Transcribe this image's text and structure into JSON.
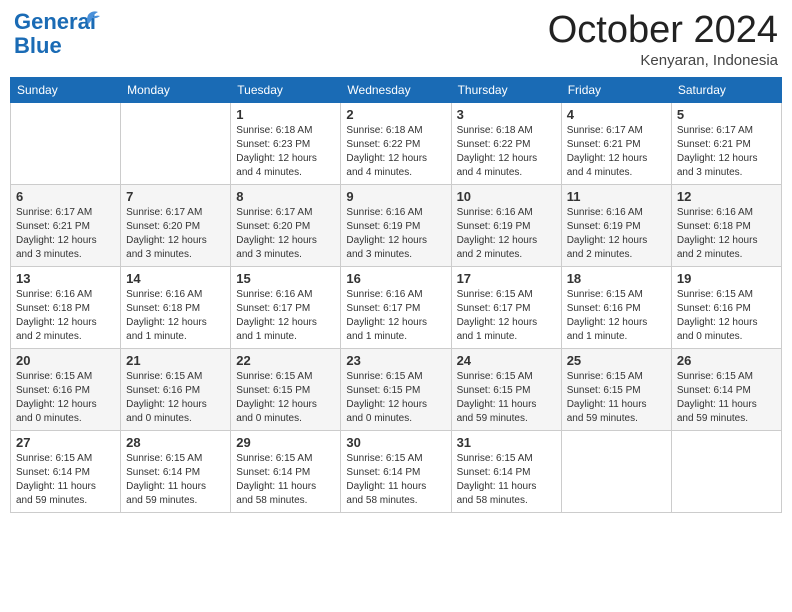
{
  "header": {
    "logo_line1": "General",
    "logo_line2": "Blue",
    "month_title": "October 2024",
    "location": "Kenyaran, Indonesia"
  },
  "weekdays": [
    "Sunday",
    "Monday",
    "Tuesday",
    "Wednesday",
    "Thursday",
    "Friday",
    "Saturday"
  ],
  "weeks": [
    [
      {
        "day": "",
        "info": ""
      },
      {
        "day": "",
        "info": ""
      },
      {
        "day": "1",
        "info": "Sunrise: 6:18 AM\nSunset: 6:23 PM\nDaylight: 12 hours\nand 4 minutes."
      },
      {
        "day": "2",
        "info": "Sunrise: 6:18 AM\nSunset: 6:22 PM\nDaylight: 12 hours\nand 4 minutes."
      },
      {
        "day": "3",
        "info": "Sunrise: 6:18 AM\nSunset: 6:22 PM\nDaylight: 12 hours\nand 4 minutes."
      },
      {
        "day": "4",
        "info": "Sunrise: 6:17 AM\nSunset: 6:21 PM\nDaylight: 12 hours\nand 4 minutes."
      },
      {
        "day": "5",
        "info": "Sunrise: 6:17 AM\nSunset: 6:21 PM\nDaylight: 12 hours\nand 3 minutes."
      }
    ],
    [
      {
        "day": "6",
        "info": "Sunrise: 6:17 AM\nSunset: 6:21 PM\nDaylight: 12 hours\nand 3 minutes."
      },
      {
        "day": "7",
        "info": "Sunrise: 6:17 AM\nSunset: 6:20 PM\nDaylight: 12 hours\nand 3 minutes."
      },
      {
        "day": "8",
        "info": "Sunrise: 6:17 AM\nSunset: 6:20 PM\nDaylight: 12 hours\nand 3 minutes."
      },
      {
        "day": "9",
        "info": "Sunrise: 6:16 AM\nSunset: 6:19 PM\nDaylight: 12 hours\nand 3 minutes."
      },
      {
        "day": "10",
        "info": "Sunrise: 6:16 AM\nSunset: 6:19 PM\nDaylight: 12 hours\nand 2 minutes."
      },
      {
        "day": "11",
        "info": "Sunrise: 6:16 AM\nSunset: 6:19 PM\nDaylight: 12 hours\nand 2 minutes."
      },
      {
        "day": "12",
        "info": "Sunrise: 6:16 AM\nSunset: 6:18 PM\nDaylight: 12 hours\nand 2 minutes."
      }
    ],
    [
      {
        "day": "13",
        "info": "Sunrise: 6:16 AM\nSunset: 6:18 PM\nDaylight: 12 hours\nand 2 minutes."
      },
      {
        "day": "14",
        "info": "Sunrise: 6:16 AM\nSunset: 6:18 PM\nDaylight: 12 hours\nand 1 minute."
      },
      {
        "day": "15",
        "info": "Sunrise: 6:16 AM\nSunset: 6:17 PM\nDaylight: 12 hours\nand 1 minute."
      },
      {
        "day": "16",
        "info": "Sunrise: 6:16 AM\nSunset: 6:17 PM\nDaylight: 12 hours\nand 1 minute."
      },
      {
        "day": "17",
        "info": "Sunrise: 6:15 AM\nSunset: 6:17 PM\nDaylight: 12 hours\nand 1 minute."
      },
      {
        "day": "18",
        "info": "Sunrise: 6:15 AM\nSunset: 6:16 PM\nDaylight: 12 hours\nand 1 minute."
      },
      {
        "day": "19",
        "info": "Sunrise: 6:15 AM\nSunset: 6:16 PM\nDaylight: 12 hours\nand 0 minutes."
      }
    ],
    [
      {
        "day": "20",
        "info": "Sunrise: 6:15 AM\nSunset: 6:16 PM\nDaylight: 12 hours\nand 0 minutes."
      },
      {
        "day": "21",
        "info": "Sunrise: 6:15 AM\nSunset: 6:16 PM\nDaylight: 12 hours\nand 0 minutes."
      },
      {
        "day": "22",
        "info": "Sunrise: 6:15 AM\nSunset: 6:15 PM\nDaylight: 12 hours\nand 0 minutes."
      },
      {
        "day": "23",
        "info": "Sunrise: 6:15 AM\nSunset: 6:15 PM\nDaylight: 12 hours\nand 0 minutes."
      },
      {
        "day": "24",
        "info": "Sunrise: 6:15 AM\nSunset: 6:15 PM\nDaylight: 11 hours\nand 59 minutes."
      },
      {
        "day": "25",
        "info": "Sunrise: 6:15 AM\nSunset: 6:15 PM\nDaylight: 11 hours\nand 59 minutes."
      },
      {
        "day": "26",
        "info": "Sunrise: 6:15 AM\nSunset: 6:14 PM\nDaylight: 11 hours\nand 59 minutes."
      }
    ],
    [
      {
        "day": "27",
        "info": "Sunrise: 6:15 AM\nSunset: 6:14 PM\nDaylight: 11 hours\nand 59 minutes."
      },
      {
        "day": "28",
        "info": "Sunrise: 6:15 AM\nSunset: 6:14 PM\nDaylight: 11 hours\nand 59 minutes."
      },
      {
        "day": "29",
        "info": "Sunrise: 6:15 AM\nSunset: 6:14 PM\nDaylight: 11 hours\nand 58 minutes."
      },
      {
        "day": "30",
        "info": "Sunrise: 6:15 AM\nSunset: 6:14 PM\nDaylight: 11 hours\nand 58 minutes."
      },
      {
        "day": "31",
        "info": "Sunrise: 6:15 AM\nSunset: 6:14 PM\nDaylight: 11 hours\nand 58 minutes."
      },
      {
        "day": "",
        "info": ""
      },
      {
        "day": "",
        "info": ""
      }
    ]
  ]
}
